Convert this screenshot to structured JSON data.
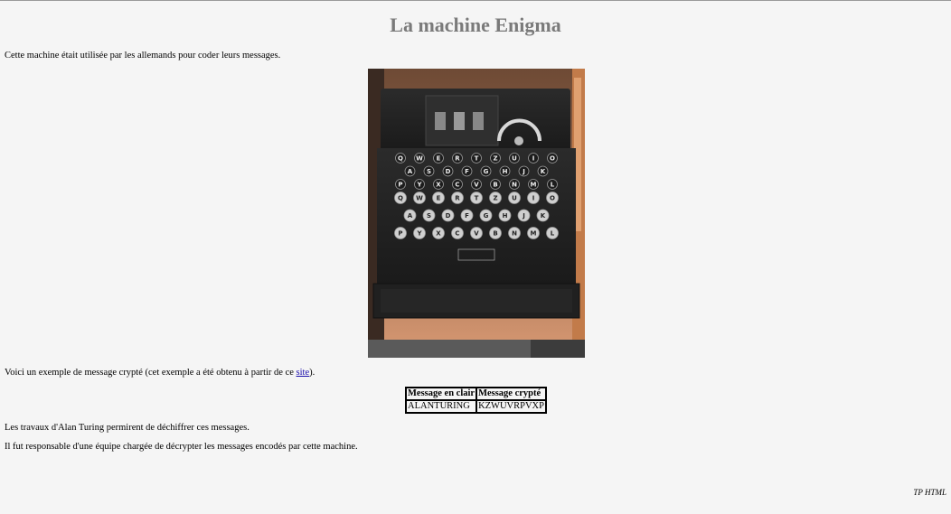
{
  "page": {
    "title": "La machine Enigma",
    "intro": "Cette machine était utilisée par les allemands pour coder leurs messages.",
    "example": {
      "before": "Voici un exemple de message crypté (cet exemple a été obtenu à partir de ce ",
      "link_text": "site",
      "after": ")."
    },
    "turing": "Les travaux d'Alan Turing permirent de déchiffrer ces messages.",
    "team": "Il fut responsable d'une équipe chargée de décrypter les messages encodés par cette machine.",
    "footer": "TP HTML"
  },
  "image": {
    "subject": "enigma-machine-photo",
    "keyboard_rows": [
      [
        "Q",
        "W",
        "E",
        "R",
        "T",
        "Z",
        "U",
        "I",
        "O"
      ],
      [
        "A",
        "S",
        "D",
        "F",
        "G",
        "H",
        "J",
        "K"
      ],
      [
        "P",
        "Y",
        "X",
        "C",
        "V",
        "B",
        "N",
        "M",
        "L"
      ]
    ]
  },
  "table": {
    "headers": [
      "Message en clair",
      "Message crypté"
    ],
    "rows": [
      [
        "ALANTURING",
        "KZWUVRPVXP"
      ]
    ]
  }
}
